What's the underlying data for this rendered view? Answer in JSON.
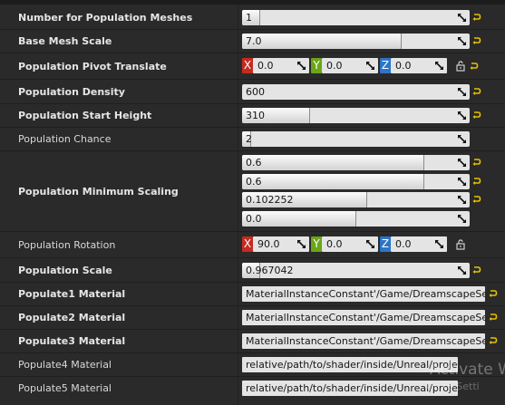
{
  "rows": [
    {
      "label": "Number for Population Meshes",
      "value": "1",
      "fill": 0.08
    },
    {
      "label": "Base Mesh Scale",
      "value": "7.0",
      "fill": 0.7
    },
    {
      "label": "Population Pivot Translate",
      "x": "0.0",
      "y": "0.0",
      "z": "0.0"
    },
    {
      "label": "Population Density",
      "value": "600",
      "fill": 0.0
    },
    {
      "label": "Population Start Height",
      "value": "310",
      "fill": 0.3
    },
    {
      "label": "Population Chance",
      "value": "2",
      "fill": 0.04
    },
    {
      "label": "Population Minimum Scaling",
      "values": [
        "0.6",
        "0.6",
        "0.102252",
        "0.0"
      ],
      "fills": [
        0.8,
        0.8,
        0.55,
        0.5
      ]
    },
    {
      "label": "Population Rotation",
      "x": "90.0",
      "y": "0.0",
      "z": "0.0"
    },
    {
      "label": "Population Scale",
      "value": "0.967042",
      "fill": 0.08
    },
    {
      "label": "Populate1 Material",
      "value": "MaterialInstanceConstant'/Game/DreamscapeSeries/"
    },
    {
      "label": "Populate2 Material",
      "value": "MaterialInstanceConstant'/Game/DreamscapeSeries/"
    },
    {
      "label": "Populate3 Material",
      "value": "MaterialInstanceConstant'/Game/DreamscapeSeries/"
    },
    {
      "label": "Populate4 Material",
      "value": "relative/path/to/shader/inside/Unreal/project"
    },
    {
      "label": "Populate5 Material",
      "value": "relative/path/to/shader/inside/Unreal/project"
    }
  ],
  "axis": {
    "x": "X",
    "y": "Y",
    "z": "Z"
  },
  "watermark": {
    "line1": "Activate W",
    "line2": "Go to Setti"
  },
  "colors": {
    "reset_arrow": "#e6c200",
    "x_axis": "#c52b20",
    "y_axis": "#6aa617",
    "z_axis": "#2c75c8"
  }
}
